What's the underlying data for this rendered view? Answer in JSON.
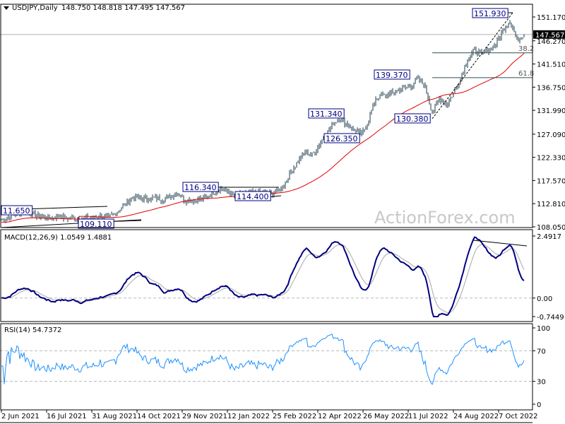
{
  "chart_data": {
    "type": "line",
    "title": "USDJPY,Daily",
    "ohlc_header": "148.750 148.818 147.495 147.567",
    "current_price": "147.567",
    "x_tick_labels": [
      "2 Jun 2021",
      "16 Jul 2021",
      "31 Aug 2021",
      "14 Oct 2021",
      "29 Nov 2021",
      "12 Jan 2022",
      "25 Feb 2022",
      "12 Apr 2022",
      "26 May 2022",
      "11 Jul 2022",
      "24 Aug 2022",
      "7 Oct 2022"
    ],
    "price_axis": {
      "ylim": [
        108.05,
        151.17
      ],
      "ticks": [
        "151.170",
        "146.270",
        "141.510",
        "136.750",
        "131.990",
        "127.090",
        "122.330",
        "117.570",
        "112.810",
        "108.050"
      ]
    },
    "weekly_closes": [
      109.6,
      110.0,
      110.8,
      111.2,
      111.0,
      110.2,
      110.2,
      109.8,
      110.4,
      109.8,
      110.0,
      109.6,
      109.8,
      109.8,
      110.3,
      109.9,
      110.6,
      112.0,
      113.5,
      114.2,
      113.9,
      113.8,
      114.0,
      113.6,
      114.5,
      115.0,
      113.5,
      113.4,
      113.7,
      114.2,
      115.2,
      115.8,
      115.3,
      114.2,
      114.6,
      115.0,
      115.0,
      115.3,
      114.8,
      115.4,
      116.5,
      119.5,
      121.5,
      123.5,
      122.8,
      125.0,
      127.2,
      129.5,
      130.2,
      129.0,
      128.0,
      127.0,
      130.0,
      134.5,
      135.0,
      135.3,
      136.0,
      136.5,
      137.0,
      138.5,
      136.8,
      131.5,
      134.5,
      133.0,
      135.5,
      138.5,
      142.5,
      144.2,
      143.5,
      144.5,
      145.5,
      148.5,
      150.5,
      146.5,
      147.6
    ],
    "moving_average_period": 55,
    "annotations": [
      "151.930",
      "139.370",
      "131.340",
      "126.350",
      "130.380",
      "116.340",
      "114.400",
      "11.650",
      "109.110"
    ],
    "fib_levels": [
      {
        "label": "38.2",
        "price": 143.8
      },
      {
        "label": "61.8",
        "price": 138.7
      }
    ],
    "macd": {
      "label": "MACD(12,26,9) 1.0549 1.4881",
      "ticks": [
        "2.4917",
        "0.00",
        "-0.7449"
      ],
      "ylim": [
        -0.7449,
        2.4917
      ]
    },
    "rsi": {
      "label": "RSI(14) 54.7372",
      "ticks": [
        "100",
        "70",
        "30",
        "0"
      ],
      "ylim": [
        0,
        100
      ]
    },
    "watermark": "ActionForex.com",
    "colors": {
      "bars": "#1c3a4a",
      "ma": "#e00000",
      "macd": "#000080",
      "signal": "#a8a8a8",
      "rsi": "#1e90ff",
      "label_border": "#000080"
    }
  }
}
